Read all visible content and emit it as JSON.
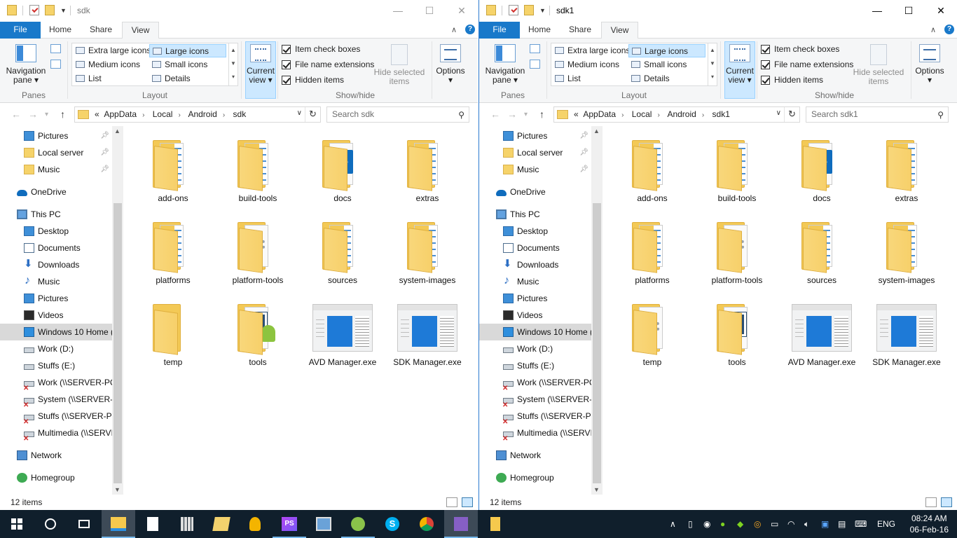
{
  "windows": [
    {
      "title": "sdk",
      "tabs": {
        "file": "File",
        "home": "Home",
        "share": "Share",
        "view": "View"
      },
      "ribbon": {
        "nav_pane": "Navigation pane",
        "panes": "Panes",
        "layout_options": [
          {
            "label": "Extra large icons",
            "selected": false
          },
          {
            "label": "Large icons",
            "selected": true
          },
          {
            "label": "Medium icons",
            "selected": false
          },
          {
            "label": "Small icons",
            "selected": false
          },
          {
            "label": "List",
            "selected": false
          },
          {
            "label": "Details",
            "selected": false
          }
        ],
        "layout": "Layout",
        "current_view": "Current view",
        "item_check_boxes": "Item check boxes",
        "file_name_extensions": "File name extensions",
        "hidden_items": "Hidden items",
        "hide_selected": "Hide selected items",
        "show_hide": "Show/hide",
        "options": "Options"
      },
      "address": {
        "overflow": "«",
        "crumbs": [
          "AppData",
          "Local",
          "Android",
          "sdk"
        ]
      },
      "search_placeholder": "Search sdk",
      "nav": [
        {
          "label": "Pictures",
          "icon": "pictures-icon",
          "pinned": true
        },
        {
          "label": "Local server",
          "icon": "folder-icon",
          "pinned": true
        },
        {
          "label": "Music",
          "icon": "folder-icon",
          "pinned": true
        },
        {
          "label": "OneDrive",
          "icon": "onedrive-icon"
        },
        {
          "label": "This PC",
          "icon": "this-pc-icon"
        },
        {
          "label": "Desktop",
          "icon": "desktop-icon"
        },
        {
          "label": "Documents",
          "icon": "documents-icon"
        },
        {
          "label": "Downloads",
          "icon": "downloads-icon"
        },
        {
          "label": "Music",
          "icon": "music-icon"
        },
        {
          "label": "Pictures",
          "icon": "pictures-icon"
        },
        {
          "label": "Videos",
          "icon": "videos-icon"
        },
        {
          "label": "Windows 10 Home (",
          "icon": "windows-drive-icon",
          "selected": true
        },
        {
          "label": "Work (D:)",
          "icon": "drive-icon"
        },
        {
          "label": "Stuffs (E:)",
          "icon": "drive-icon"
        },
        {
          "label": "Work (\\\\SERVER-PC)",
          "icon": "network-drive-icon"
        },
        {
          "label": "System (\\\\SERVER-P",
          "icon": "network-drive-icon"
        },
        {
          "label": "Stuffs (\\\\SERVER-PC",
          "icon": "network-drive-icon"
        },
        {
          "label": "Multimedia (\\\\SERVI",
          "icon": "network-drive-icon"
        },
        {
          "label": "Network",
          "icon": "network-icon"
        },
        {
          "label": "Homegroup",
          "icon": "homegroup-icon"
        }
      ],
      "items": [
        {
          "label": "add-ons",
          "kind": "folder-docs"
        },
        {
          "label": "build-tools",
          "kind": "folder-docs"
        },
        {
          "label": "docs",
          "kind": "folder-edge"
        },
        {
          "label": "extras",
          "kind": "folder-docs"
        },
        {
          "label": "platforms",
          "kind": "folder-docs"
        },
        {
          "label": "platform-tools",
          "kind": "folder-gear"
        },
        {
          "label": "sources",
          "kind": "folder-docs"
        },
        {
          "label": "system-images",
          "kind": "folder-docs"
        },
        {
          "label": "temp",
          "kind": "folder-empty"
        },
        {
          "label": "tools",
          "kind": "folder-android"
        },
        {
          "label": "AVD Manager.exe",
          "kind": "exe"
        },
        {
          "label": "SDK Manager.exe",
          "kind": "exe"
        }
      ],
      "status": "12 items"
    },
    {
      "title": "sdk1",
      "tabs": {
        "file": "File",
        "home": "Home",
        "share": "Share",
        "view": "View"
      },
      "ribbon": {
        "nav_pane": "Navigation pane",
        "panes": "Panes",
        "layout_options": [
          {
            "label": "Extra large icons",
            "selected": false
          },
          {
            "label": "Large icons",
            "selected": true
          },
          {
            "label": "Medium icons",
            "selected": false
          },
          {
            "label": "Small icons",
            "selected": false
          },
          {
            "label": "List",
            "selected": false
          },
          {
            "label": "Details",
            "selected": false
          }
        ],
        "layout": "Layout",
        "current_view": "Current view",
        "item_check_boxes": "Item check boxes",
        "file_name_extensions": "File name extensions",
        "hidden_items": "Hidden items",
        "hide_selected": "Hide selected items",
        "show_hide": "Show/hide",
        "options": "Options"
      },
      "address": {
        "overflow": "«",
        "crumbs": [
          "AppData",
          "Local",
          "Android",
          "sdk1"
        ]
      },
      "search_placeholder": "Search sdk1",
      "nav": [
        {
          "label": "Pictures",
          "icon": "pictures-icon",
          "pinned": true
        },
        {
          "label": "Local server",
          "icon": "folder-icon",
          "pinned": true
        },
        {
          "label": "Music",
          "icon": "folder-icon",
          "pinned": true
        },
        {
          "label": "OneDrive",
          "icon": "onedrive-icon"
        },
        {
          "label": "This PC",
          "icon": "this-pc-icon"
        },
        {
          "label": "Desktop",
          "icon": "desktop-icon"
        },
        {
          "label": "Documents",
          "icon": "documents-icon"
        },
        {
          "label": "Downloads",
          "icon": "downloads-icon"
        },
        {
          "label": "Music",
          "icon": "music-icon"
        },
        {
          "label": "Pictures",
          "icon": "pictures-icon"
        },
        {
          "label": "Videos",
          "icon": "videos-icon"
        },
        {
          "label": "Windows 10 Home (",
          "icon": "windows-drive-icon",
          "selected": true
        },
        {
          "label": "Work (D:)",
          "icon": "drive-icon"
        },
        {
          "label": "Stuffs (E:)",
          "icon": "drive-icon"
        },
        {
          "label": "Work (\\\\SERVER-PC)",
          "icon": "network-drive-icon"
        },
        {
          "label": "System (\\\\SERVER-P",
          "icon": "network-drive-icon"
        },
        {
          "label": "Stuffs (\\\\SERVER-PC",
          "icon": "network-drive-icon"
        },
        {
          "label": "Multimedia (\\\\SERVI",
          "icon": "network-drive-icon"
        },
        {
          "label": "Network",
          "icon": "network-icon"
        },
        {
          "label": "Homegroup",
          "icon": "homegroup-icon"
        }
      ],
      "items": [
        {
          "label": "add-ons",
          "kind": "folder-docs"
        },
        {
          "label": "build-tools",
          "kind": "folder-docs"
        },
        {
          "label": "docs",
          "kind": "folder-edge"
        },
        {
          "label": "extras",
          "kind": "folder-docs"
        },
        {
          "label": "platforms",
          "kind": "folder-docs"
        },
        {
          "label": "platform-tools",
          "kind": "folder-gear"
        },
        {
          "label": "sources",
          "kind": "folder-docs"
        },
        {
          "label": "system-images",
          "kind": "folder-docs"
        },
        {
          "label": "temp",
          "kind": "folder-gear"
        },
        {
          "label": "tools",
          "kind": "folder-tools"
        },
        {
          "label": "AVD Manager.exe",
          "kind": "exe"
        },
        {
          "label": "SDK Manager.exe",
          "kind": "exe"
        }
      ],
      "status": "12 items"
    }
  ],
  "taskbar": {
    "apps": [
      "start-icon",
      "cortana-icon",
      "task-view-icon",
      "file-explorer-icon",
      "notepad-icon",
      "calculator-icon",
      "explorer-folder-icon",
      "lightbulb-icon",
      "phpstorm-icon",
      "photos-icon",
      "android-studio-icon",
      "skype-icon",
      "chrome-icon",
      "visual-studio-icon",
      "folder-icon"
    ],
    "language": "ENG",
    "time": "08:24 AM",
    "date": "06-Feb-16"
  },
  "colors": {
    "file_tab": "#1979ca",
    "selection": "#cce8ff",
    "taskbar": "#101f2c",
    "active_border": "#2b79d0"
  }
}
